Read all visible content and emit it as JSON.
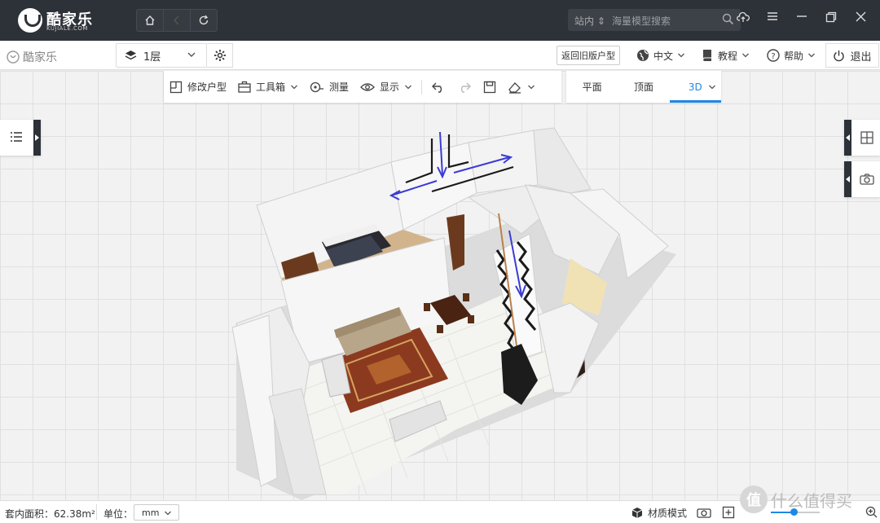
{
  "app": {
    "logo": "酷家乐",
    "logo_sub": "KUJIALE.COM",
    "brand_small": "酷家乐"
  },
  "titlebar": {
    "search_scope": "站内",
    "search_placeholder": "海量模型搜索"
  },
  "toolbar": {
    "floor": "1层",
    "old_layout": "返回旧版户型",
    "language": "中文",
    "tutorial": "教程",
    "help": "帮助",
    "exit": "退出"
  },
  "tools": {
    "modify": "修改户型",
    "toolbox": "工具箱",
    "measure": "测量",
    "display": "显示"
  },
  "views": {
    "plan": "平面",
    "top": "顶面",
    "3d": "3D",
    "active": "3D"
  },
  "status": {
    "area": "套内面积：62.38m²",
    "unit_label": "单位：",
    "unit": "mm",
    "material_mode": "材质模式"
  },
  "watermark": {
    "logo": "值",
    "text": "什么值得买"
  },
  "colors": {
    "titlebar": "#2d3138",
    "accent": "#1e88e5",
    "annotation": "#3b3bd6"
  }
}
